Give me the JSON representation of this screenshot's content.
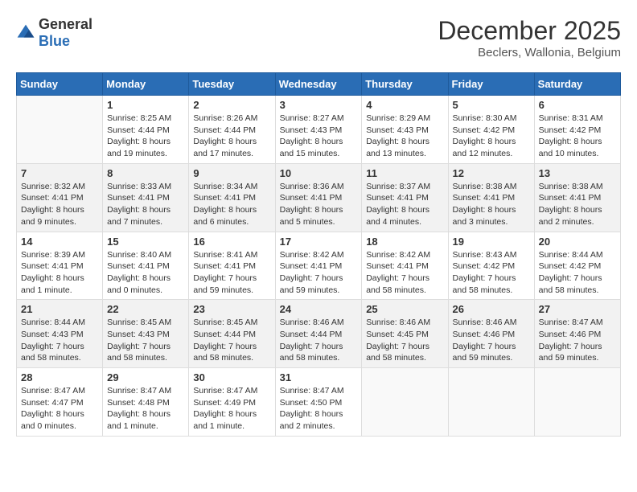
{
  "header": {
    "logo_general": "General",
    "logo_blue": "Blue",
    "month_title": "December 2025",
    "subtitle": "Beclers, Wallonia, Belgium"
  },
  "days_of_week": [
    "Sunday",
    "Monday",
    "Tuesday",
    "Wednesday",
    "Thursday",
    "Friday",
    "Saturday"
  ],
  "weeks": [
    [
      {
        "day": "",
        "content": ""
      },
      {
        "day": "1",
        "content": "Sunrise: 8:25 AM\nSunset: 4:44 PM\nDaylight: 8 hours and 19 minutes."
      },
      {
        "day": "2",
        "content": "Sunrise: 8:26 AM\nSunset: 4:44 PM\nDaylight: 8 hours and 17 minutes."
      },
      {
        "day": "3",
        "content": "Sunrise: 8:27 AM\nSunset: 4:43 PM\nDaylight: 8 hours and 15 minutes."
      },
      {
        "day": "4",
        "content": "Sunrise: 8:29 AM\nSunset: 4:43 PM\nDaylight: 8 hours and 13 minutes."
      },
      {
        "day": "5",
        "content": "Sunrise: 8:30 AM\nSunset: 4:42 PM\nDaylight: 8 hours and 12 minutes."
      },
      {
        "day": "6",
        "content": "Sunrise: 8:31 AM\nSunset: 4:42 PM\nDaylight: 8 hours and 10 minutes."
      }
    ],
    [
      {
        "day": "7",
        "content": "Sunrise: 8:32 AM\nSunset: 4:41 PM\nDaylight: 8 hours and 9 minutes."
      },
      {
        "day": "8",
        "content": "Sunrise: 8:33 AM\nSunset: 4:41 PM\nDaylight: 8 hours and 7 minutes."
      },
      {
        "day": "9",
        "content": "Sunrise: 8:34 AM\nSunset: 4:41 PM\nDaylight: 8 hours and 6 minutes."
      },
      {
        "day": "10",
        "content": "Sunrise: 8:36 AM\nSunset: 4:41 PM\nDaylight: 8 hours and 5 minutes."
      },
      {
        "day": "11",
        "content": "Sunrise: 8:37 AM\nSunset: 4:41 PM\nDaylight: 8 hours and 4 minutes."
      },
      {
        "day": "12",
        "content": "Sunrise: 8:38 AM\nSunset: 4:41 PM\nDaylight: 8 hours and 3 minutes."
      },
      {
        "day": "13",
        "content": "Sunrise: 8:38 AM\nSunset: 4:41 PM\nDaylight: 8 hours and 2 minutes."
      }
    ],
    [
      {
        "day": "14",
        "content": "Sunrise: 8:39 AM\nSunset: 4:41 PM\nDaylight: 8 hours and 1 minute."
      },
      {
        "day": "15",
        "content": "Sunrise: 8:40 AM\nSunset: 4:41 PM\nDaylight: 8 hours and 0 minutes."
      },
      {
        "day": "16",
        "content": "Sunrise: 8:41 AM\nSunset: 4:41 PM\nDaylight: 7 hours and 59 minutes."
      },
      {
        "day": "17",
        "content": "Sunrise: 8:42 AM\nSunset: 4:41 PM\nDaylight: 7 hours and 59 minutes."
      },
      {
        "day": "18",
        "content": "Sunrise: 8:42 AM\nSunset: 4:41 PM\nDaylight: 7 hours and 58 minutes."
      },
      {
        "day": "19",
        "content": "Sunrise: 8:43 AM\nSunset: 4:42 PM\nDaylight: 7 hours and 58 minutes."
      },
      {
        "day": "20",
        "content": "Sunrise: 8:44 AM\nSunset: 4:42 PM\nDaylight: 7 hours and 58 minutes."
      }
    ],
    [
      {
        "day": "21",
        "content": "Sunrise: 8:44 AM\nSunset: 4:43 PM\nDaylight: 7 hours and 58 minutes."
      },
      {
        "day": "22",
        "content": "Sunrise: 8:45 AM\nSunset: 4:43 PM\nDaylight: 7 hours and 58 minutes."
      },
      {
        "day": "23",
        "content": "Sunrise: 8:45 AM\nSunset: 4:44 PM\nDaylight: 7 hours and 58 minutes."
      },
      {
        "day": "24",
        "content": "Sunrise: 8:46 AM\nSunset: 4:44 PM\nDaylight: 7 hours and 58 minutes."
      },
      {
        "day": "25",
        "content": "Sunrise: 8:46 AM\nSunset: 4:45 PM\nDaylight: 7 hours and 58 minutes."
      },
      {
        "day": "26",
        "content": "Sunrise: 8:46 AM\nSunset: 4:46 PM\nDaylight: 7 hours and 59 minutes."
      },
      {
        "day": "27",
        "content": "Sunrise: 8:47 AM\nSunset: 4:46 PM\nDaylight: 7 hours and 59 minutes."
      }
    ],
    [
      {
        "day": "28",
        "content": "Sunrise: 8:47 AM\nSunset: 4:47 PM\nDaylight: 8 hours and 0 minutes."
      },
      {
        "day": "29",
        "content": "Sunrise: 8:47 AM\nSunset: 4:48 PM\nDaylight: 8 hours and 1 minute."
      },
      {
        "day": "30",
        "content": "Sunrise: 8:47 AM\nSunset: 4:49 PM\nDaylight: 8 hours and 1 minute."
      },
      {
        "day": "31",
        "content": "Sunrise: 8:47 AM\nSunset: 4:50 PM\nDaylight: 8 hours and 2 minutes."
      },
      {
        "day": "",
        "content": ""
      },
      {
        "day": "",
        "content": ""
      },
      {
        "day": "",
        "content": ""
      }
    ]
  ]
}
